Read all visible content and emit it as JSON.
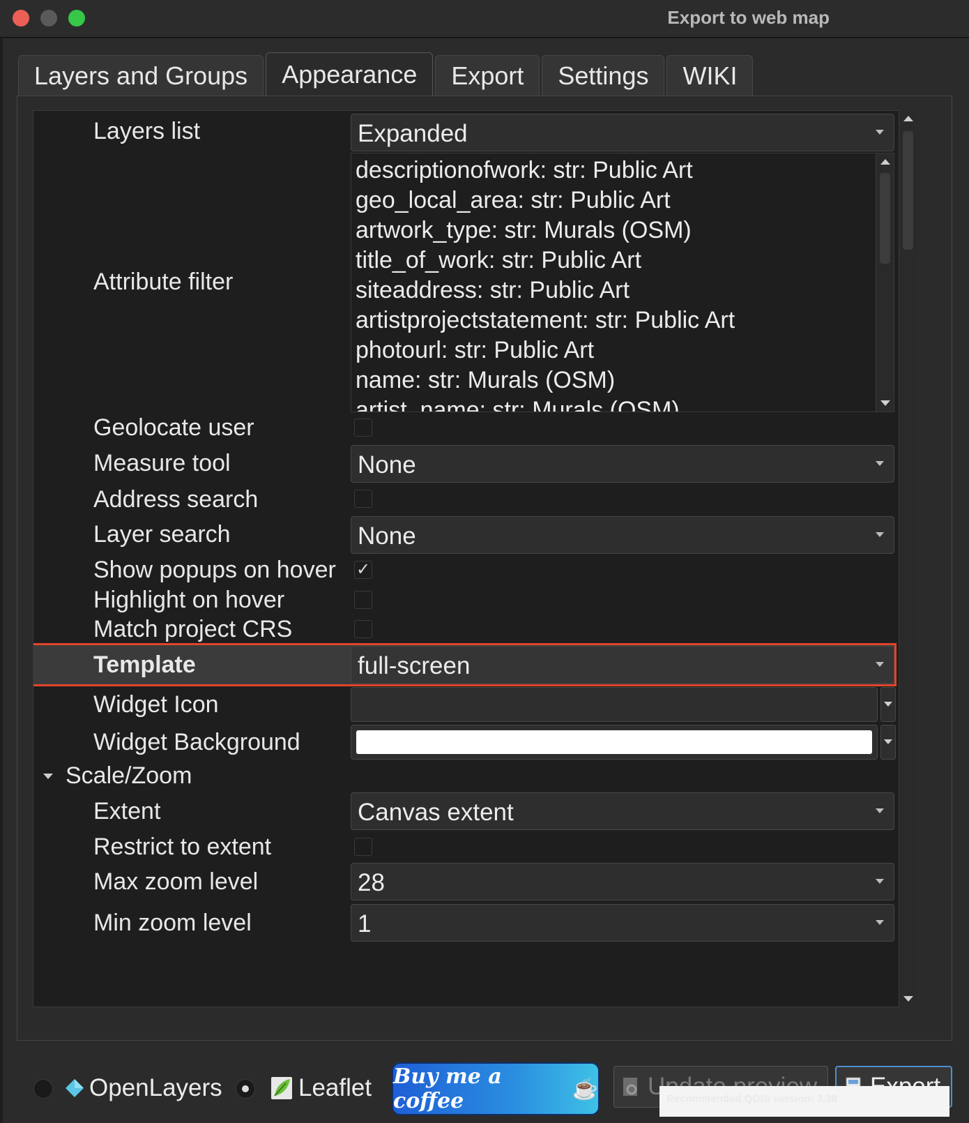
{
  "window": {
    "title": "Export to web map"
  },
  "tabs": [
    {
      "label": "Layers and Groups"
    },
    {
      "label": "Appearance"
    },
    {
      "label": "Export"
    },
    {
      "label": "Settings"
    },
    {
      "label": "WIKI"
    }
  ],
  "appearance": {
    "layers_list": {
      "label": "Layers list",
      "value": "Expanded"
    },
    "attribute_filter": {
      "label": "Attribute filter",
      "items": [
        "descriptionofwork: str: Public Art",
        "geo_local_area: str: Public Art",
        "artwork_type: str: Murals (OSM)",
        "title_of_work: str: Public Art",
        "siteaddress: str: Public Art",
        "artistprojectstatement: str: Public Art",
        "photourl: str: Public Art",
        "name: str: Murals (OSM)",
        "artist_name: str: Murals (OSM)"
      ]
    },
    "geolocate_user": {
      "label": "Geolocate user",
      "checked": false
    },
    "measure_tool": {
      "label": "Measure tool",
      "value": "None"
    },
    "address_search": {
      "label": "Address search",
      "checked": false
    },
    "layer_search": {
      "label": "Layer search",
      "value": "None"
    },
    "show_popups_on_hover": {
      "label": "Show popups on hover",
      "checked": true,
      "mark": "✓"
    },
    "highlight_on_hover": {
      "label": "Highlight on hover",
      "checked": false
    },
    "match_project_crs": {
      "label": "Match project CRS",
      "checked": false
    },
    "template": {
      "label": "Template",
      "value": "full-screen"
    },
    "widget_icon": {
      "label": "Widget Icon",
      "color": "#2e2e2e"
    },
    "widget_background": {
      "label": "Widget Background",
      "color": "#ffffff"
    },
    "scale_zoom": {
      "group_label": "Scale/Zoom",
      "extent": {
        "label": "Extent",
        "value": "Canvas extent"
      },
      "restrict_to_extent": {
        "label": "Restrict to extent",
        "checked": false
      },
      "max_zoom": {
        "label": "Max zoom level",
        "value": "28"
      },
      "min_zoom": {
        "label": "Min zoom level",
        "value": "1"
      }
    }
  },
  "bottom": {
    "mapping_library": [
      {
        "label": "OpenLayers",
        "selected": false,
        "icon": "openlayers-icon"
      },
      {
        "label": "Leaflet",
        "selected": true,
        "icon": "leaflet-icon"
      }
    ],
    "coffee_label": "Buy me a coffee",
    "update_preview_label": "Update preview",
    "export_label": "Export",
    "version_note": "Recommended QGIS version: 3.38"
  },
  "colors": {
    "highlight_border": "#e2442a",
    "export_border": "#4d8fcf"
  }
}
